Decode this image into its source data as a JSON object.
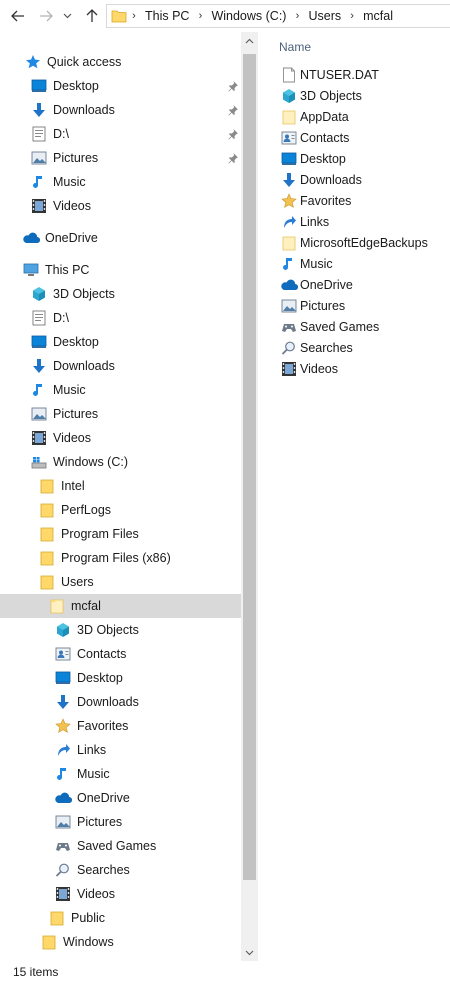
{
  "address": {
    "crumbs": [
      "This PC",
      "Windows (C:)",
      "Users",
      "mcfal"
    ]
  },
  "nav": {
    "quick_access": "Quick access",
    "qa_items": [
      {
        "label": "Desktop",
        "icon": "desktop-icon"
      },
      {
        "label": "Downloads",
        "icon": "downloads-icon"
      },
      {
        "label": "D:\\",
        "icon": "drive-icon"
      },
      {
        "label": "Pictures",
        "icon": "pictures-icon"
      },
      {
        "label": "Music",
        "icon": "music-icon"
      },
      {
        "label": "Videos",
        "icon": "videos-icon"
      }
    ],
    "onedrive": "OneDrive",
    "this_pc": "This PC",
    "pc_items": [
      {
        "label": "3D Objects",
        "icon": "3d-objects-icon"
      },
      {
        "label": "D:\\",
        "icon": "drive-icon"
      },
      {
        "label": "Desktop",
        "icon": "desktop-icon"
      },
      {
        "label": "Downloads",
        "icon": "downloads-icon"
      },
      {
        "label": "Music",
        "icon": "music-icon"
      },
      {
        "label": "Pictures",
        "icon": "pictures-icon"
      },
      {
        "label": "Videos",
        "icon": "videos-icon"
      },
      {
        "label": "Windows (C:)",
        "icon": "windows-drive-icon"
      }
    ],
    "c_items": [
      {
        "label": "Intel",
        "icon": "folder-icon"
      },
      {
        "label": "PerfLogs",
        "icon": "folder-icon"
      },
      {
        "label": "Program Files",
        "icon": "folder-icon"
      },
      {
        "label": "Program Files (x86)",
        "icon": "folder-icon"
      },
      {
        "label": "Users",
        "icon": "folder-icon"
      }
    ],
    "selected_user": "mcfal",
    "user_items": [
      {
        "label": "3D Objects",
        "icon": "3d-objects-icon"
      },
      {
        "label": "Contacts",
        "icon": "contacts-icon"
      },
      {
        "label": "Desktop",
        "icon": "desktop-icon"
      },
      {
        "label": "Downloads",
        "icon": "downloads-icon"
      },
      {
        "label": "Favorites",
        "icon": "favorites-icon"
      },
      {
        "label": "Links",
        "icon": "links-icon"
      },
      {
        "label": "Music",
        "icon": "music-icon"
      },
      {
        "label": "OneDrive",
        "icon": "onedrive-icon"
      },
      {
        "label": "Pictures",
        "icon": "pictures-icon"
      },
      {
        "label": "Saved Games",
        "icon": "saved-games-icon"
      },
      {
        "label": "Searches",
        "icon": "searches-icon"
      },
      {
        "label": "Videos",
        "icon": "videos-icon"
      }
    ],
    "public": "Public",
    "windows": "Windows"
  },
  "content": {
    "column_name": "Name",
    "files": [
      {
        "label": "NTUSER.DAT",
        "icon": "file-icon"
      },
      {
        "label": "3D Objects",
        "icon": "3d-objects-icon"
      },
      {
        "label": "AppData",
        "icon": "folder-light-icon"
      },
      {
        "label": "Contacts",
        "icon": "contacts-icon"
      },
      {
        "label": "Desktop",
        "icon": "desktop-icon"
      },
      {
        "label": "Downloads",
        "icon": "downloads-icon"
      },
      {
        "label": "Favorites",
        "icon": "favorites-icon"
      },
      {
        "label": "Links",
        "icon": "links-icon"
      },
      {
        "label": "MicrosoftEdgeBackups",
        "icon": "folder-light-icon"
      },
      {
        "label": "Music",
        "icon": "music-icon"
      },
      {
        "label": "OneDrive",
        "icon": "onedrive-icon"
      },
      {
        "label": "Pictures",
        "icon": "pictures-icon"
      },
      {
        "label": "Saved Games",
        "icon": "saved-games-icon"
      },
      {
        "label": "Searches",
        "icon": "searches-icon"
      },
      {
        "label": "Videos",
        "icon": "videos-icon"
      }
    ]
  },
  "status": {
    "item_count": "15 items"
  },
  "colors": {
    "selection": "#d9d9d9",
    "folder": "#ffd86b",
    "accent": "#0078d7",
    "header_text": "#4c607a"
  }
}
